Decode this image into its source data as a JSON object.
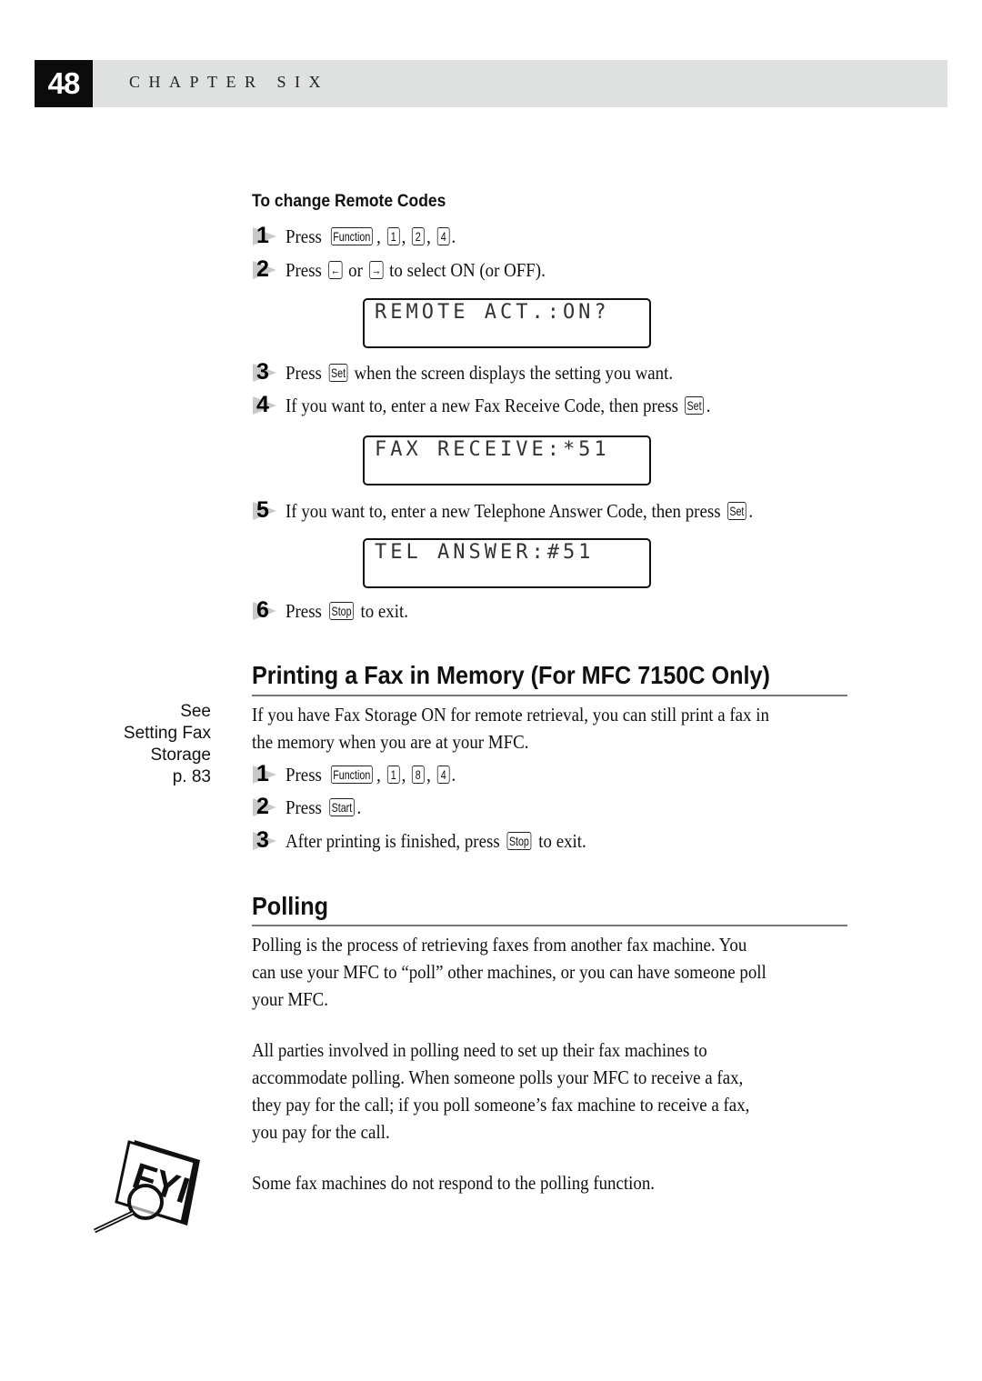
{
  "header": {
    "page_number": "48",
    "chapter": "CHAPTER SIX"
  },
  "remote_codes": {
    "subheading": "To change Remote Codes",
    "steps": [
      {
        "num": "1",
        "pre": "Press",
        "keys": [
          "Function",
          "1",
          "2",
          "4"
        ],
        "post": "."
      },
      {
        "num": "2",
        "pre": "Press",
        "key_a": "←",
        "mid": "or",
        "key_b": "→",
        "post": "to select ON (or OFF)."
      },
      {
        "num": "3",
        "pre": "Press",
        "key": "Set",
        "post": "when the screen displays the setting you want."
      },
      {
        "num": "4",
        "pre": "If you want to, enter a new Fax Receive Code, then press",
        "key": "Set",
        "post": "."
      },
      {
        "num": "5",
        "pre": "If you want to, enter a new Telephone Answer Code, then press",
        "key": "Set",
        "post": "."
      },
      {
        "num": "6",
        "pre": "Press",
        "key": "Stop",
        "post": "to exit."
      }
    ],
    "displays": [
      "REMOTE ACT.:ON?",
      "FAX RECEIVE:*51",
      "TEL ANSWER:#51"
    ]
  },
  "printing": {
    "heading": "Printing a Fax in Memory (For MFC 7150C Only)",
    "intro_lines": [
      "If you have Fax Storage ON for remote retrieval, you can still print a fax in",
      "the memory when you are at your MFC."
    ],
    "steps": [
      {
        "num": "1",
        "pre": "Press",
        "keys": [
          "Function",
          "1",
          "8",
          "4"
        ],
        "post": "."
      },
      {
        "num": "2",
        "pre": "Press",
        "key": "Start",
        "post": "."
      },
      {
        "num": "3",
        "pre": "After printing is finished, press",
        "key": "Stop",
        "post": "to exit."
      }
    ],
    "margin_note": [
      "See",
      "Setting Fax",
      "Storage",
      "p. 83"
    ]
  },
  "polling": {
    "heading": "Polling",
    "para1": [
      "Polling is the process of retrieving faxes from another fax machine.  You",
      "can use your MFC to “poll” other machines, or you can have someone poll",
      "your MFC."
    ],
    "para2": [
      "All parties involved in polling need to set up their fax machines to",
      "accommodate polling.  When someone polls your MFC to receive a fax,",
      "they pay for the call; if you poll someone’s fax machine to receive a fax,",
      "you pay for the call."
    ],
    "fyi_note": "Some fax machines do not respond to the polling function.",
    "fyi_icon": "fyi-magnifier-icon"
  }
}
